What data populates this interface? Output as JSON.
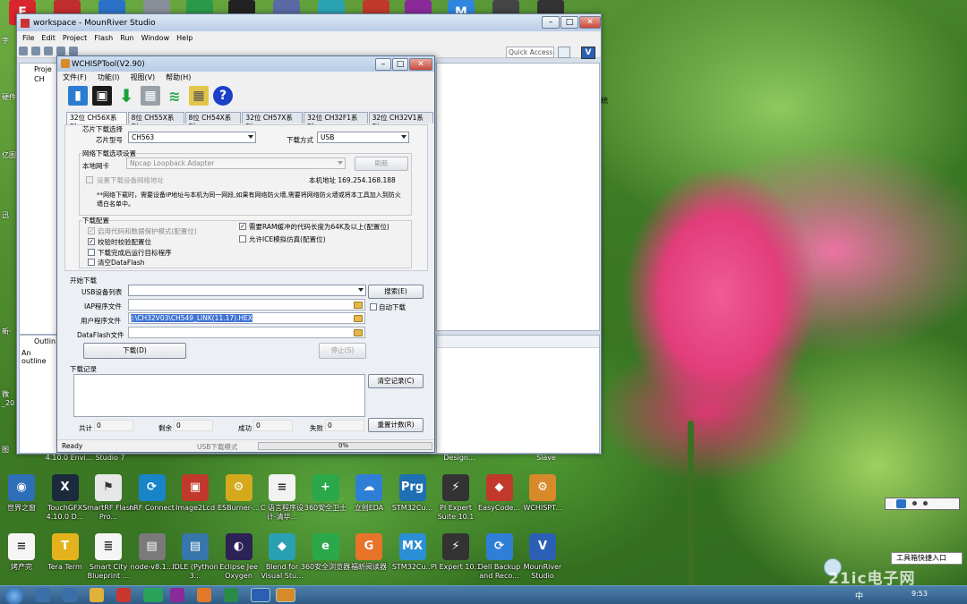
{
  "desktop": {
    "top_icons": [
      {
        "letter": "F",
        "color": "#d9262e"
      },
      {
        "letter": "",
        "color": "#c22d2d"
      },
      {
        "letter": "",
        "color": "#2b72c8"
      },
      {
        "letter": "",
        "color": "#8a8f99"
      },
      {
        "letter": "",
        "color": "#2a9a4a"
      },
      {
        "letter": "",
        "color": "#222"
      },
      {
        "letter": "",
        "color": "#5b6aa6"
      },
      {
        "letter": "",
        "color": "#2aa3b3"
      },
      {
        "letter": "",
        "color": "#c0392b"
      },
      {
        "letter": "",
        "color": "#8a2a9a"
      },
      {
        "letter": "M",
        "color": "#2e86de"
      },
      {
        "letter": "",
        "color": "#444"
      },
      {
        "letter": "",
        "color": "#333"
      }
    ],
    "left_labels": [
      "字",
      "硬件",
      "亿图",
      "迅",
      "新·",
      "微_20",
      "图"
    ],
    "below_window_labels": [
      "4.10.0 Envi...",
      "Studio 7",
      "Design...",
      "Slave"
    ],
    "row1": [
      {
        "name": "世界之窗",
        "icon": "globe-icon",
        "color": "#2f6fb7",
        "glyph": "◉"
      },
      {
        "name": "TouchGFX 4.10.0 D...",
        "icon": "touchgfx-icon",
        "color": "#1b2a3c",
        "glyph": "X"
      },
      {
        "name": "SmartRF Flash Pro...",
        "icon": "ti-icon",
        "color": "#e7e7e7",
        "glyph": "⚑"
      },
      {
        "name": "nRF Connect",
        "icon": "nrf-icon",
        "color": "#1a84c9",
        "glyph": "⟳"
      },
      {
        "name": "Image2Lcd",
        "icon": "image2lcd-icon",
        "color": "#c0392b",
        "glyph": "▣"
      },
      {
        "name": "ESBurner-...",
        "icon": "burner-icon",
        "color": "#d4a91c",
        "glyph": "⚙"
      },
      {
        "name": "C 语言程序设计-清华...",
        "icon": "document-icon",
        "color": "#f2f2f2",
        "glyph": "≡"
      },
      {
        "name": "360安全卫士",
        "icon": "360-icon",
        "color": "#2aa84a",
        "glyph": "+"
      },
      {
        "name": "立创EDA",
        "icon": "easyeda-icon",
        "color": "#2f7fd7",
        "glyph": "☁"
      },
      {
        "name": "STM32Cu...",
        "icon": "stm32-icon",
        "color": "#1e6fb3",
        "glyph": "Prg"
      },
      {
        "name": "PI Expert Suite 10.1",
        "icon": "pi-expert-icon",
        "color": "#333",
        "glyph": "⚡"
      },
      {
        "name": "EasyCode...",
        "icon": "easycode-icon",
        "color": "#c0392b",
        "glyph": "◆"
      },
      {
        "name": "WCHISPT...",
        "icon": "wchisp-icon",
        "color": "#d78a2a",
        "glyph": "⚙"
      }
    ],
    "row2": [
      {
        "name": "烤产完",
        "icon": "text-file-icon",
        "color": "#f5f5f5",
        "glyph": "≡"
      },
      {
        "name": "Tera Term",
        "icon": "teraterm-icon",
        "color": "#e3b21c",
        "glyph": "T"
      },
      {
        "name": "Smart City Blueprint ...",
        "icon": "blueprint-icon",
        "color": "#f5f5f5",
        "glyph": "≣"
      },
      {
        "name": "node-v8.1...",
        "icon": "installer-icon",
        "color": "#7a7a7a",
        "glyph": "▤"
      },
      {
        "name": "IDLE (Python 3...",
        "icon": "idle-icon",
        "color": "#3776ab",
        "glyph": "▤"
      },
      {
        "name": "Eclipse Jee Oxygen",
        "icon": "eclipse-icon",
        "color": "#2c2255",
        "glyph": "◐"
      },
      {
        "name": "Blend for Visual Stu...",
        "icon": "blend-icon",
        "color": "#2aa0b3",
        "glyph": "◆"
      },
      {
        "name": "360安全浏览器",
        "icon": "360-browser-icon",
        "color": "#2aa84a",
        "glyph": "e"
      },
      {
        "name": "福昕阅读器",
        "icon": "foxit-icon",
        "color": "#e8742a",
        "glyph": "G"
      },
      {
        "name": "STM32Cu...",
        "icon": "stm32mx-icon",
        "color": "#2b8fd6",
        "glyph": "MX"
      },
      {
        "name": "PI Expert 10.1",
        "icon": "pi-expert-icon",
        "color": "#333",
        "glyph": "⚡"
      },
      {
        "name": "Dell Backup and Reco...",
        "icon": "dell-backup-icon",
        "color": "#2f7fd7",
        "glyph": "⟳"
      },
      {
        "name": "MounRiver Studio",
        "icon": "mounriver-icon",
        "color": "#2a5fb3",
        "glyph": "V"
      }
    ]
  },
  "ide": {
    "title": "workspace - MounRiver Studio",
    "menu": [
      "File",
      "Edit",
      "Project",
      "Flash",
      "Run",
      "Window",
      "Help"
    ],
    "quick_access": "Quick Access",
    "project_label": "Proje",
    "project_item": "CH",
    "outline_label": "Outlin",
    "outline_text": "An outline",
    "right_label": "统"
  },
  "wch": {
    "title": "WCHISPTool(V2.90)",
    "menu": [
      "文件(F)",
      "功能(I)",
      "视图(V)",
      "帮助(H)"
    ],
    "tabs": [
      "32位 CH56X系列",
      "8位 CH55X系列",
      "8位 CH54X系列",
      "32位 CH57X系列",
      "32位 CH32F1系列",
      "32位 CH32V1系列"
    ],
    "chip_section": "芯片下载选择",
    "chip_model_label": "芯片型号",
    "chip_model": "CH563",
    "download_mode_label": "下载方式",
    "download_mode": "USB",
    "net_section": "网络下载选项设置",
    "nic_label": "本地网卡",
    "nic_value": "Npcap Loopback Adapter",
    "refresh_btn": "刷新",
    "set_ip_label": "设置下载设备网络地址",
    "local_ip": "本机地址 169.254.168.188",
    "net_note": "**网络下载时，需要设备IP地址与本机为同一网段,如果有网络防火墙,需要将网络防火墙或将本工具加入到防火墙白名单中。",
    "dl_config": "下载配置",
    "opt1": "启用代码和数据保护模式(配置位)",
    "opt2": "校验时校验配置位",
    "opt3": "下载完成后运行目标程序",
    "opt4": "清空DataFlash",
    "opt5": "需要RAM缓冲的代码长度为64K及以上(配置位)",
    "opt6": "允许ICE模拟仿真(配置位)",
    "start_section": "开始下载",
    "usb_list_label": "USB设备列表",
    "search_btn": "搜索(E)",
    "iap_label": "IAP程序文件",
    "auto_dl": "自动下载",
    "user_file_label": "用户程序文件",
    "user_file": "J:\\CH32V03\\CH549_LINK(11.17).HEX",
    "dataflash_label": "DataFlash文件",
    "download_btn": "下载(D)",
    "stop_btn": "停止(S)",
    "log_section": "下载记录",
    "clear_btn": "清空记录(C)",
    "reset_btn": "重置计数(R)",
    "total_label": "共计",
    "total": "0",
    "remain_label": "剩余",
    "remain": "0",
    "success_label": "成功",
    "success": "0",
    "fail_label": "失败",
    "fail": "0",
    "status_ready": "Ready",
    "status_mode": "USB下载模式",
    "status_pct": "0%"
  },
  "systray": {
    "tooltip": "工具箱快捷入口",
    "time": "9:53",
    "ime": "中",
    "watermark": "21ic电子网"
  }
}
